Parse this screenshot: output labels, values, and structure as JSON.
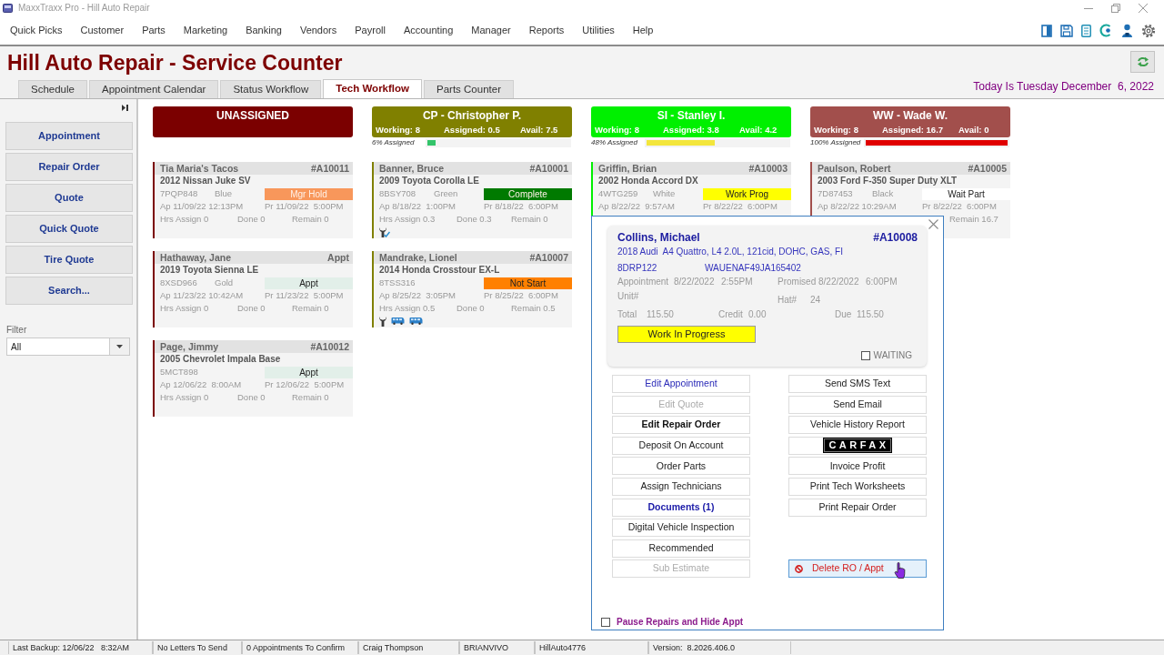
{
  "window": {
    "title": "MaxxTraxx Pro - Hill Auto Repair"
  },
  "menu": [
    "Quick Picks",
    "Customer",
    "Parts",
    "Marketing",
    "Banking",
    "Vendors",
    "Payroll",
    "Accounting",
    "Manager",
    "Reports",
    "Utilities",
    "Help"
  ],
  "header": {
    "title": "Hill Auto Repair - Service Counter",
    "date": "Today Is Tuesday December  6, 2022"
  },
  "tabs": [
    {
      "label": "Schedule",
      "selected": false
    },
    {
      "label": "Appointment Calendar",
      "selected": false
    },
    {
      "label": "Status Workflow",
      "selected": false
    },
    {
      "label": "Tech Workflow",
      "selected": true
    },
    {
      "label": "Parts Counter",
      "selected": false
    }
  ],
  "sidebar": {
    "buttons": [
      "Appointment",
      "Repair Order",
      "Quote",
      "Quick Quote",
      "Tire Quote",
      "Search..."
    ],
    "filter": {
      "label": "Filter",
      "value": "All"
    }
  },
  "columns": [
    {
      "title": "UNASSIGNED",
      "color": "#7b0000",
      "cards": [
        {
          "customer": "Tia Maria's Tacos",
          "ref": "#A10011",
          "vehicle": "2012 Nissan Juke SV",
          "plate": "7PQP848",
          "vehicle_color": "Blue",
          "status": {
            "label": "Mgr Hold",
            "color": "#f8975b",
            "light_text": true
          },
          "appointment": "Ap 11/09/22 12:13PM",
          "promised": "Pr 11/09/22  5:00PM",
          "hours": {
            "assign": "Hrs Assign 0",
            "done": "Done 0",
            "remain": "Remain 0"
          }
        },
        {
          "customer": "Hathaway, Jane",
          "ref": "Appt",
          "vehicle": "2019 Toyota Sienna LE",
          "plate": "8XSD966",
          "vehicle_color": "Gold",
          "status": {
            "label": "Appt",
            "color": "#e2efe9",
            "light_text": false
          },
          "appointment": "Ap 11/23/22 10:42AM",
          "promised": "Pr 11/23/22  5:00PM",
          "hours": {
            "assign": "Hrs Assign 0",
            "done": "Done 0",
            "remain": "Remain 0"
          }
        },
        {
          "customer": "Page, Jimmy",
          "ref": "#A10012",
          "vehicle": "2005 Chevrolet Impala Base",
          "plate": "5MCT898",
          "status": {
            "label": "Appt",
            "color": "#e2efe9",
            "light_text": false
          },
          "appointment": "Ap 12/06/22  8:00AM",
          "promised": "Pr 12/06/22  5:00PM",
          "hours": {
            "assign": "Hrs Assign 0",
            "done": "Done 0",
            "remain": "Remain 0"
          }
        }
      ]
    },
    {
      "title": "CP - Christopher P.",
      "color": "#808000",
      "stats": [
        "Working: 8",
        "Assigned: 0.5",
        "Avail: 7.5"
      ],
      "meter": {
        "label": "6% Assigned",
        "level": 0.06,
        "color": "#33c46a"
      },
      "cards": [
        {
          "customer": "Banner, Bruce",
          "ref": "#A10001",
          "vehicle": "2009 Toyota Corolla LE",
          "plate": "8BSY708",
          "vehicle_color": "Green",
          "status": {
            "label": "Complete",
            "color": "#007a00",
            "light_text": true
          },
          "appointment": "Ap 8/18/22  1:00PM",
          "promised": "Pr 8/18/22  6:00PM",
          "hours": {
            "assign": "Hrs Assign 0.3",
            "done": "Done 0.3",
            "remain": "Remain 0"
          },
          "indicators": [
            {
              "kind": "wrench_check"
            }
          ]
        },
        {
          "customer": "Mandrake, Lionel",
          "ref": "#A10007",
          "vehicle": "2014 Honda Crosstour EX-L",
          "plate": "8TSS316",
          "status": {
            "label": "Not Start",
            "color": "#ff8000",
            "light_text": false
          },
          "appointment": "Ap 8/25/22  3:05PM",
          "promised": "Pr 8/25/22  6:00PM",
          "hours": {
            "assign": "Hrs Assign 0.5",
            "done": "Done 0",
            "remain": "Remain 0.5"
          },
          "indicators": [
            {
              "kind": "wrench"
            },
            {
              "kind": "bus"
            },
            {
              "kind": "bus"
            }
          ]
        }
      ]
    },
    {
      "title": "SI - Stanley I.",
      "color": "#00f000",
      "stats": [
        "Working: 8",
        "Assigned: 3.8",
        "Avail: 4.2"
      ],
      "meter": {
        "label": "48% Assigned",
        "level": 0.48,
        "color": "#f3e63c"
      },
      "cards": [
        {
          "customer": "Griffin, Brian",
          "ref": "#A10003",
          "vehicle": "2002 Honda Accord DX",
          "plate": "4WTG259",
          "vehicle_color": "White",
          "status": {
            "label": "Work Prog",
            "color": "#ffff00",
            "light_text": false
          },
          "appointment": "Ap 8/22/22  9:57AM",
          "promised": "Pr 8/22/22  6:00PM"
        }
      ]
    },
    {
      "title": "WW - Wade W.",
      "color": "#a24f4c",
      "stats": [
        "Working: 8",
        "Assigned: 16.7",
        "Avail: 0"
      ],
      "meter": {
        "label": "100% Assigned",
        "level": 1,
        "color": "#e00000"
      },
      "cards": [
        {
          "customer": "Paulson, Robert",
          "ref": "#A10005",
          "vehicle": "2003 Ford F-350 Super Duty XLT",
          "plate": "7D87453",
          "vehicle_color": "Black",
          "status": {
            "label": "Wait Part",
            "color": "#ffffff",
            "light_text": false
          },
          "appointment": "Ap 8/22/22 10:29AM",
          "promised": "Pr 8/22/22  6:00PM",
          "hours": {
            "remain": "Remain 16.7"
          }
        }
      ]
    }
  ],
  "popup": {
    "customer": "Collins, Michael",
    "ref": "#A10008",
    "vehicle": "2018 Audi  A4 Quattro, L4 2.0L, 121cid, DOHC, GAS, FI",
    "plate": "8DRP122",
    "vin": "WAUENAF49JA165402",
    "appointment": {
      "label": "Appointment",
      "date": "8/22/2022",
      "time": "2:55PM"
    },
    "promised": {
      "label": "Promised",
      "date": "8/22/2022",
      "time": "6:00PM"
    },
    "unit": {
      "label": "Unit#"
    },
    "hat": {
      "label": "Hat#",
      "value": "24"
    },
    "total": {
      "label": "Total",
      "value": "115.50"
    },
    "credit": {
      "label": "Credit",
      "value": "0.00"
    },
    "due": {
      "label": "Due",
      "value": "115.50"
    },
    "status_button": "Work In Progress",
    "waiting": {
      "label": "WAITING",
      "checked": false
    },
    "actions_left": [
      {
        "label": "Edit Appointment",
        "kind": "link"
      },
      {
        "label": "Edit Quote",
        "kind": "disabled"
      },
      {
        "label": "Edit Repair Order",
        "kind": "bold"
      },
      {
        "label": "Deposit On Account",
        "kind": "normal"
      },
      {
        "label": "Order Parts",
        "kind": "normal"
      },
      {
        "label": "Assign Technicians",
        "kind": "normal"
      },
      {
        "label": "Documents (1)",
        "kind": "link_bold"
      },
      {
        "label": "Digital Vehicle Inspection",
        "kind": "normal"
      },
      {
        "label": "Recommended",
        "kind": "normal"
      },
      {
        "label": "Sub Estimate",
        "kind": "disabled"
      }
    ],
    "actions_right": [
      {
        "label": "Send SMS Text",
        "kind": "normal"
      },
      {
        "label": "Send Email",
        "kind": "normal"
      },
      {
        "label": "Vehicle History Report",
        "kind": "normal"
      },
      {
        "label": "CARFAX",
        "kind": "logo"
      },
      {
        "label": "Invoice Profit",
        "kind": "normal"
      },
      {
        "label": "Print Tech Worksheets",
        "kind": "normal"
      },
      {
        "label": "Print Repair Order",
        "kind": "normal"
      }
    ],
    "delete_button": {
      "label": "Delete RO / Appt",
      "hovered": true
    },
    "pause": {
      "label": "Pause Repairs and Hide Appt",
      "checked": false
    }
  },
  "status_bar": [
    "Last Backup: 12/06/22   8:32AM",
    "No Letters To Send",
    "0 Appointments To Confirm",
    "Craig Thompson",
    "BRIANVIVO",
    "HillAuto4776",
    "Version:  8.2026.406.0"
  ]
}
